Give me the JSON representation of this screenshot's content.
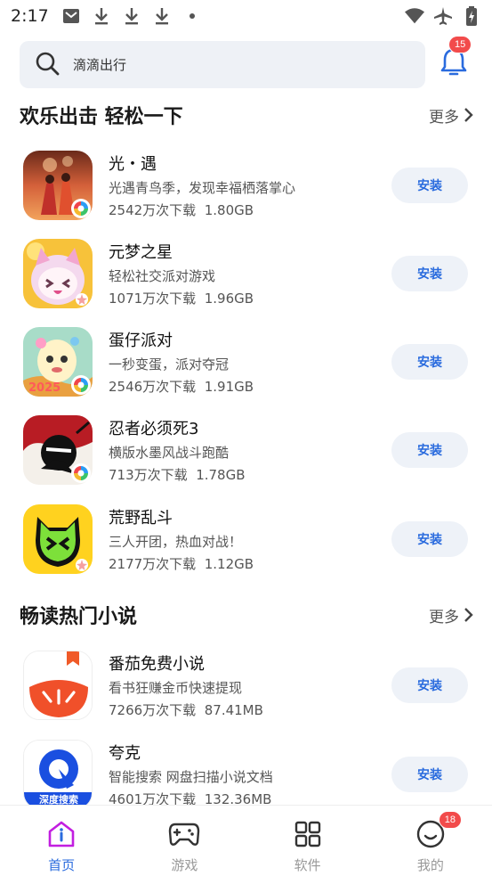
{
  "status_bar": {
    "time": "2:17"
  },
  "search": {
    "placeholder": "滴滴出行"
  },
  "notifications": {
    "count": "15"
  },
  "sections": [
    {
      "title": "欢乐出击 轻松一下",
      "more_label": "更多",
      "apps": [
        {
          "name": "光・遇",
          "desc": "光遇青鸟季，发现幸福栖落掌心",
          "downloads": "2542万次下载",
          "size": "1.80GB",
          "install_label": "安装"
        },
        {
          "name": "元梦之星",
          "desc": "轻松社交派对游戏",
          "downloads": "1071万次下载",
          "size": "1.96GB",
          "install_label": "安装"
        },
        {
          "name": "蛋仔派对",
          "desc": "一秒变蛋，派对夺冠",
          "downloads": "2546万次下载",
          "size": "1.91GB",
          "install_label": "安装"
        },
        {
          "name": "忍者必须死3",
          "desc": "横版水墨风战斗跑酷",
          "downloads": "713万次下载",
          "size": "1.78GB",
          "install_label": "安装"
        },
        {
          "name": "荒野乱斗",
          "desc": "三人开团，热血对战！",
          "downloads": "2177万次下载",
          "size": "1.12GB",
          "install_label": "安装"
        }
      ]
    },
    {
      "title": "畅读热门小说",
      "more_label": "更多",
      "apps": [
        {
          "name": "番茄免费小说",
          "desc": "看书狂赚金币快速提现",
          "downloads": "7266万次下载",
          "size": "87.41MB",
          "install_label": "安装"
        },
        {
          "name": "夸克",
          "desc": "智能搜索 网盘扫描小说文档",
          "downloads": "4601万次下载",
          "size": "132.36MB",
          "install_label": "安装",
          "icon_text": "深度搜索"
        }
      ]
    }
  ],
  "bottom_nav": {
    "items": [
      {
        "label": "首页",
        "active": true
      },
      {
        "label": "游戏"
      },
      {
        "label": "软件"
      },
      {
        "label": "我的",
        "badge": "18"
      }
    ]
  },
  "colors": {
    "accent": "#2a6bde",
    "badge": "#f24b4b",
    "search_bg": "#eef1f6",
    "install_bg": "#eef2f8"
  }
}
